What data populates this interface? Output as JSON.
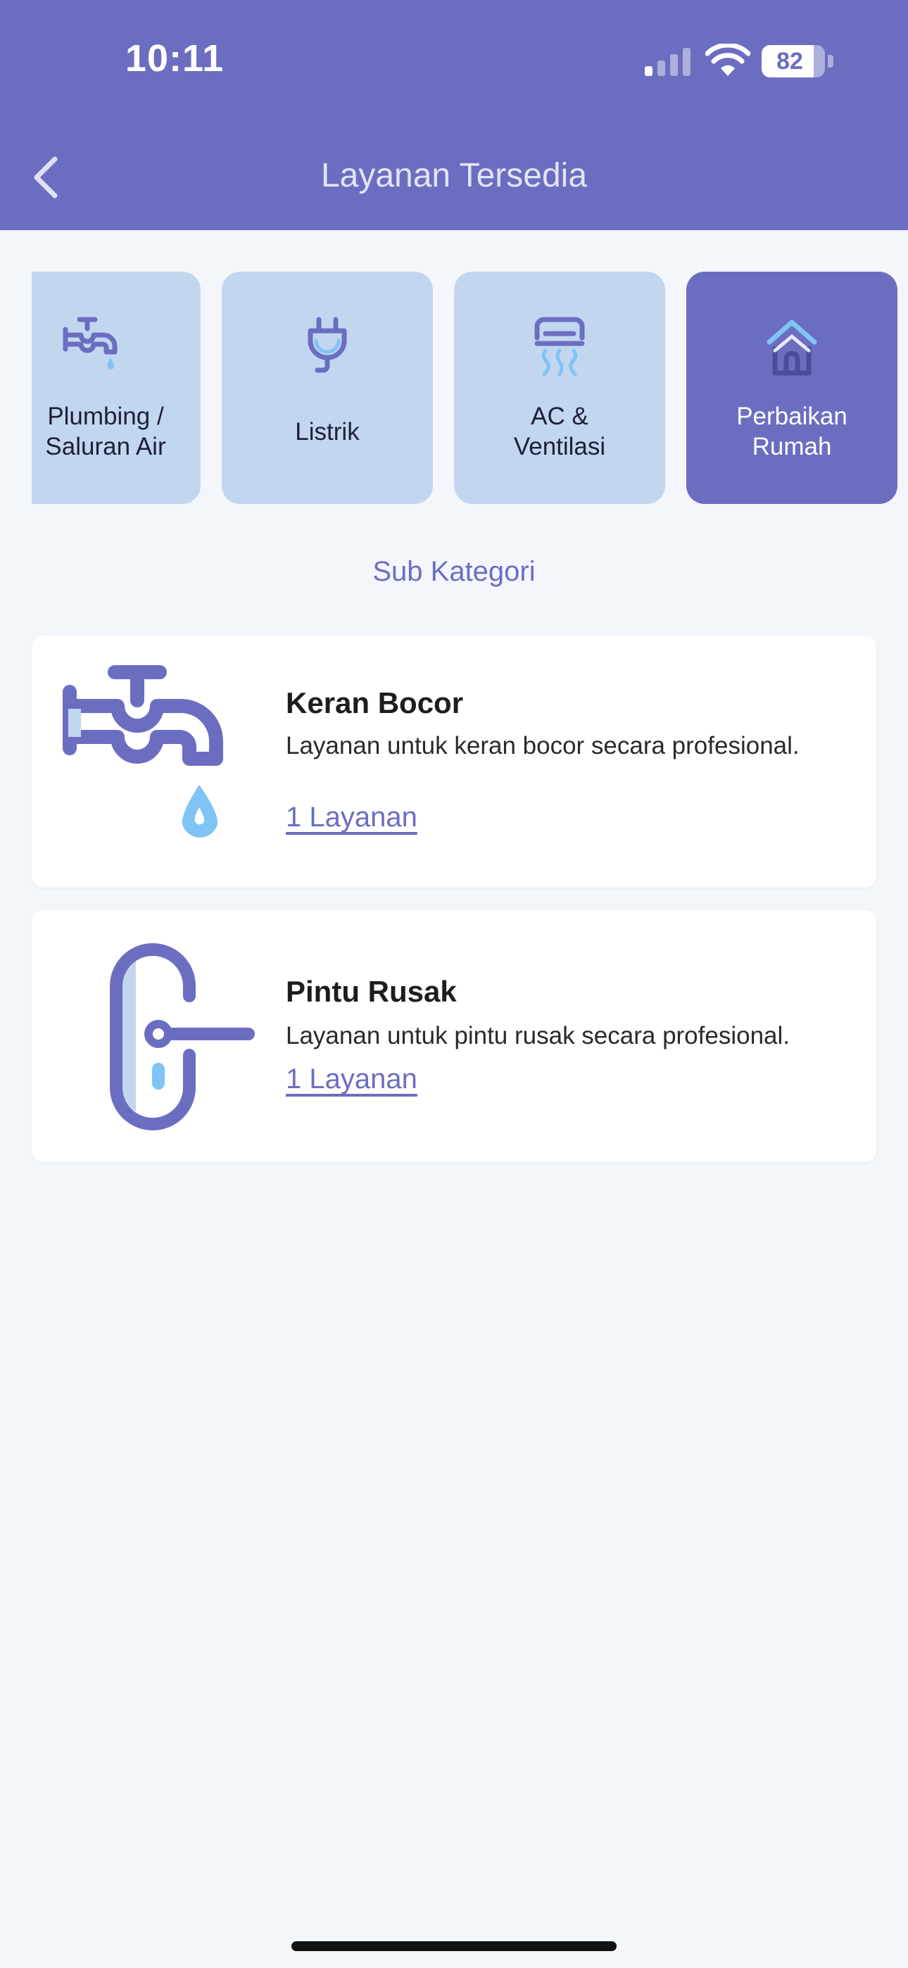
{
  "status_bar": {
    "time": "10:11",
    "battery": "82",
    "battery_level": 0.82
  },
  "header": {
    "title": "Layanan Tersedia"
  },
  "categories": [
    {
      "label": "Plumbing /\nSaluran Air",
      "icon": "faucet-icon",
      "active": false
    },
    {
      "label": "Listrik",
      "icon": "plug-icon",
      "active": false
    },
    {
      "label": "AC &\nVentilasi",
      "icon": "air-conditioner-icon",
      "active": false
    },
    {
      "label": "Perbaikan\nRumah",
      "icon": "house-icon",
      "active": true
    }
  ],
  "section": {
    "title": "Sub Kategori"
  },
  "subcategories": [
    {
      "title": "Keran Bocor",
      "description": "Layanan untuk keran bocor secara profesional.",
      "link": "1 Layanan",
      "icon": "leaking-faucet-icon"
    },
    {
      "title": "Pintu Rusak",
      "description": "Layanan untuk pintu rusak secara profesional.",
      "link": "1 Layanan",
      "icon": "door-handle-icon"
    }
  ],
  "colors": {
    "primary": "#6b6ec0",
    "card_inactive": "#c3d6f0",
    "accent_light": "#7fc4f5",
    "background": "#f3f6fb"
  }
}
